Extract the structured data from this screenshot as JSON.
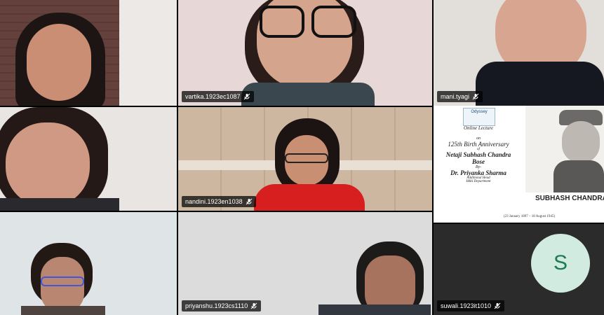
{
  "participants": [
    {
      "name": "",
      "has_tag": false
    },
    {
      "name": "vartika.1923ec1087",
      "has_tag": true,
      "mic": "mic-muted-icon"
    },
    {
      "name": "mani.tyagi",
      "has_tag": true,
      "mic": "mic-muted-icon"
    },
    {
      "name": "",
      "has_tag": false
    },
    {
      "name": "nandini.1923en1038",
      "has_tag": true,
      "mic": "mic-muted-icon"
    },
    {
      "name": "",
      "has_tag": false,
      "shared_content": true
    },
    {
      "name": "",
      "has_tag": false
    },
    {
      "name": "priyanshu.1923cs1110",
      "has_tag": true,
      "mic": "mic-muted-icon"
    },
    {
      "name": "suwali.1923it1010",
      "has_tag": true,
      "mic": "mic-muted-icon",
      "avatar_initial": "S"
    }
  ],
  "poster": {
    "logo_text": "Odyssey",
    "lines": [
      "Online Lecture",
      "on",
      "125th Birth Anniversary",
      "of",
      "Netaji Subhash Chandra",
      "Bose",
      "By-",
      "Dr. Priyanka Sharma",
      "Additional Head",
      "H&S Department"
    ],
    "banner": "SUBHASH CHANDRA",
    "dates": "(23 January 1897 – 18 August 1945)"
  },
  "colors": {
    "avatar_bg": "#d2ebe0",
    "avatar_fg": "#1d7a52"
  }
}
